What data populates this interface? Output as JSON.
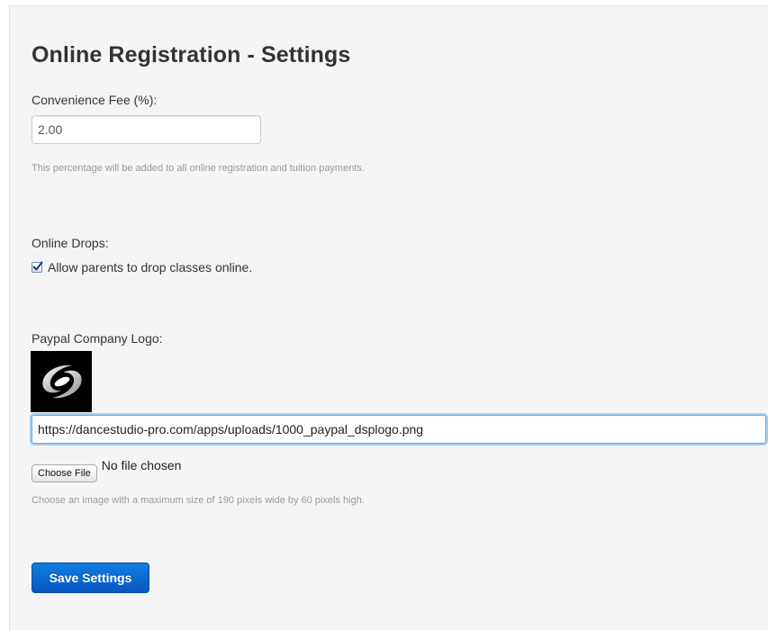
{
  "page": {
    "title": "Online Registration - Settings"
  },
  "convenience_fee": {
    "label": "Convenience Fee (%):",
    "value": "2.00",
    "help": "This percentage will be added to all online registration and tuition payments."
  },
  "online_drops": {
    "label": "Online Drops:",
    "checkbox_label": "Allow parents to drop classes online.",
    "checked": true
  },
  "paypal_logo": {
    "label": "Paypal Company Logo:",
    "url": "https://dancestudio-pro.com/apps/uploads/1000_paypal_dsplogo.png",
    "choose_file_label": "Choose File",
    "no_file_text": "No file chosen",
    "help": "Choose an image with a maximum size of 190 pixels wide by 60 pixels high."
  },
  "actions": {
    "save_label": "Save Settings"
  },
  "colors": {
    "panel_background": "#f5f5f5",
    "primary_button": "#0a63d0",
    "focus_ring": "#52a8ec",
    "help_text": "#999999"
  },
  "icons": {
    "checkbox": "checkmark-icon",
    "logo": "swirl-logo"
  }
}
